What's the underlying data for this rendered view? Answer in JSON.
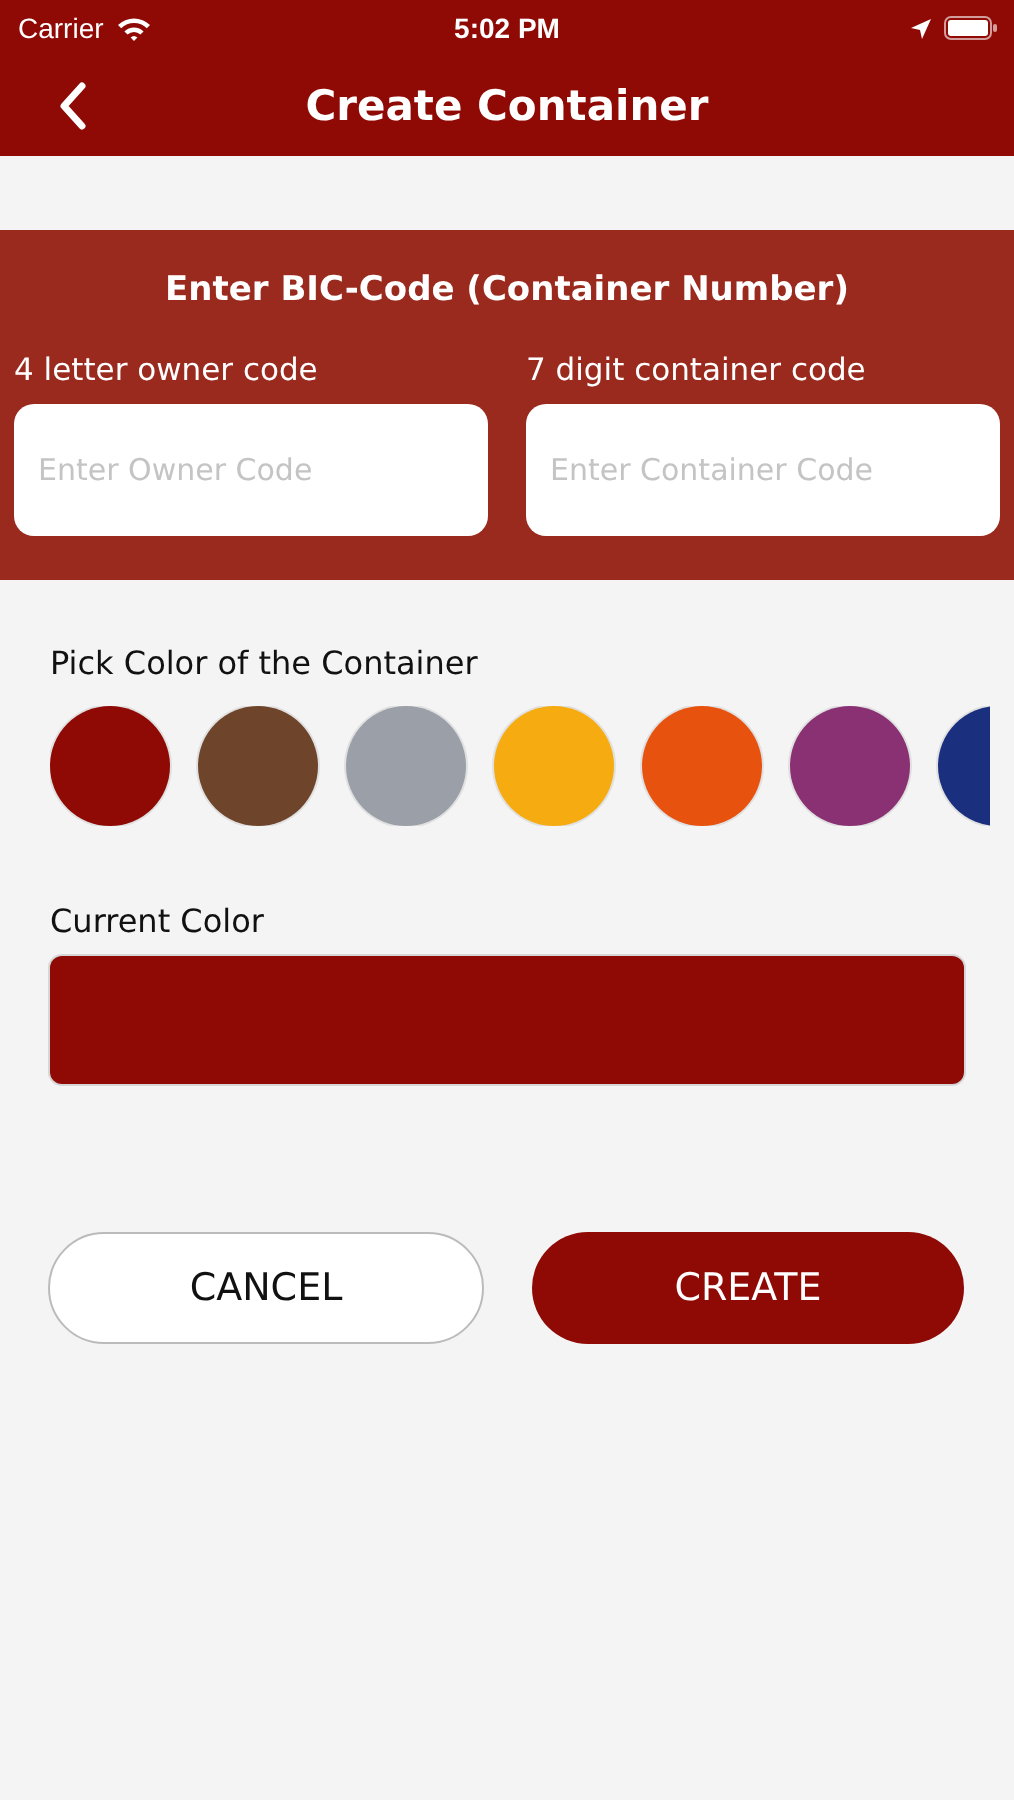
{
  "status_bar": {
    "carrier": "Carrier",
    "time": "5:02 PM"
  },
  "nav_bar": {
    "title": "Create Container"
  },
  "bic_panel": {
    "title": "Enter BIC-Code (Container Number)",
    "fields": [
      {
        "label": "4 letter owner code",
        "placeholder": "Enter Owner Code"
      },
      {
        "label": "7 digit container code",
        "placeholder": "Enter Container Code"
      }
    ]
  },
  "color_picker": {
    "label": "Pick Color of the Container",
    "swatches": [
      {
        "color": "#8f0a05"
      },
      {
        "color": "#6e442a"
      },
      {
        "color": "#9a9fa8"
      },
      {
        "color": "#f6ab10"
      },
      {
        "color": "#e8520f"
      },
      {
        "color": "#8a3174"
      },
      {
        "color": "#1b2f7f"
      }
    ]
  },
  "current_color": {
    "label": "Current Color",
    "color": "#8f0a05"
  },
  "buttons": [
    {
      "kind": "secondary",
      "label": "CANCEL"
    },
    {
      "kind": "primary",
      "label": "CREATE"
    }
  ]
}
